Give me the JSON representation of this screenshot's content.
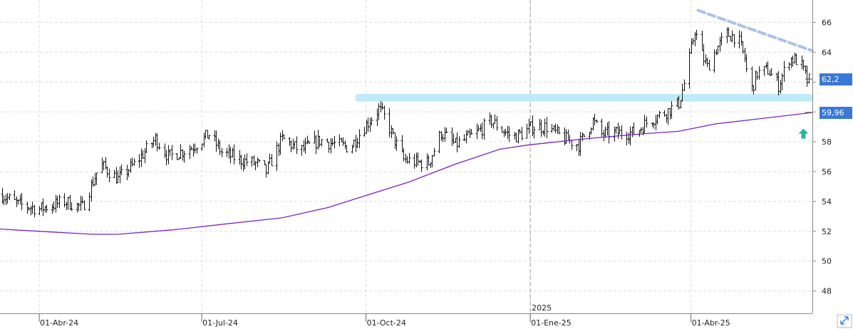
{
  "chart_data": {
    "type": "candlestick",
    "title": "",
    "xlabel": "",
    "ylabel": "",
    "x_range": [
      "2024-03-10",
      "2025-06-08"
    ],
    "ylim": [
      46.5,
      67.5
    ],
    "y_ticks": [
      48,
      50,
      52,
      54,
      56,
      58,
      60,
      62,
      64,
      66
    ],
    "y_tick_labels": [
      "48",
      "50",
      "52",
      "54",
      "56",
      "58",
      "60",
      "62",
      "64",
      "66"
    ],
    "x_ticks": [
      {
        "date": "2024-04-01",
        "label": "01-Abr-24"
      },
      {
        "date": "2024-07-01",
        "label": "01-Jul-24"
      },
      {
        "date": "2024-10-01",
        "label": "01-Oct-24"
      },
      {
        "date": "2025-01-01",
        "label": "01-Ene-25"
      },
      {
        "date": "2025-04-01",
        "label": "01-Abr-25"
      }
    ],
    "year_marker": {
      "date": "2025-01-01",
      "label": "2025"
    },
    "grid": true,
    "price_badge": {
      "value": 62.2,
      "label": "62,2",
      "color": "#3a78d6"
    },
    "ma_badge": {
      "value": 59.96,
      "label": "59,96",
      "color": "#3a78d6"
    },
    "price_anchors": [
      [
        "2024-03-10",
        54.5
      ],
      [
        "2024-03-20",
        53.8
      ],
      [
        "2024-04-01",
        53.5
      ],
      [
        "2024-04-15",
        54.0
      ],
      [
        "2024-04-25",
        53.6
      ],
      [
        "2024-05-05",
        56.5
      ],
      [
        "2024-05-15",
        55.5
      ],
      [
        "2024-05-25",
        56.6
      ],
      [
        "2024-06-05",
        58.2
      ],
      [
        "2024-06-12",
        57.0
      ],
      [
        "2024-06-25",
        57.6
      ],
      [
        "2024-07-05",
        58.5
      ],
      [
        "2024-07-12",
        57.3
      ],
      [
        "2024-07-22",
        56.8
      ],
      [
        "2024-08-01",
        56.5
      ],
      [
        "2024-08-06",
        56.0
      ],
      [
        "2024-08-15",
        58.2
      ],
      [
        "2024-08-25",
        57.4
      ],
      [
        "2024-09-05",
        58.1
      ],
      [
        "2024-09-15",
        57.8
      ],
      [
        "2024-09-22",
        57.6
      ],
      [
        "2024-09-28",
        58.7
      ],
      [
        "2024-10-08",
        60.2
      ],
      [
        "2024-10-12",
        59.5
      ],
      [
        "2024-10-16",
        58.3
      ],
      [
        "2024-10-22",
        56.8
      ],
      [
        "2024-10-30",
        56.6
      ],
      [
        "2024-11-05",
        56.6
      ],
      [
        "2024-11-12",
        58.6
      ],
      [
        "2024-11-20",
        57.8
      ],
      [
        "2024-12-01",
        58.5
      ],
      [
        "2024-12-10",
        59.4
      ],
      [
        "2024-12-16",
        58.8
      ],
      [
        "2024-12-22",
        58.3
      ],
      [
        "2024-12-28",
        58.6
      ],
      [
        "2025-01-02",
        59.0
      ],
      [
        "2025-01-10",
        59.0
      ],
      [
        "2025-01-20",
        58.2
      ],
      [
        "2025-01-28",
        57.8
      ],
      [
        "2025-02-05",
        59.4
      ],
      [
        "2025-02-10",
        58.5
      ],
      [
        "2025-02-20",
        58.6
      ],
      [
        "2025-03-01",
        58.6
      ],
      [
        "2025-03-08",
        59.4
      ],
      [
        "2025-03-18",
        60.0
      ],
      [
        "2025-03-25",
        60.6
      ],
      [
        "2025-03-29",
        62.3
      ],
      [
        "2025-04-03",
        65.5
      ],
      [
        "2025-04-07",
        63.8
      ],
      [
        "2025-04-10",
        63.0
      ],
      [
        "2025-04-15",
        64.2
      ],
      [
        "2025-04-21",
        65.2
      ],
      [
        "2025-04-27",
        65.0
      ],
      [
        "2025-05-01",
        63.6
      ],
      [
        "2025-05-04",
        61.2
      ],
      [
        "2025-05-08",
        62.6
      ],
      [
        "2025-05-14",
        62.8
      ],
      [
        "2025-05-20",
        61.8
      ],
      [
        "2025-05-26",
        63.6
      ],
      [
        "2025-06-01",
        63.4
      ],
      [
        "2025-06-05",
        62.1
      ],
      [
        "2025-06-08",
        62.2
      ]
    ],
    "moving_average": [
      [
        "2024-03-10",
        52.15
      ],
      [
        "2024-04-01",
        52.0
      ],
      [
        "2024-05-01",
        51.8
      ],
      [
        "2024-05-15",
        51.8
      ],
      [
        "2024-06-15",
        52.1
      ],
      [
        "2024-07-15",
        52.5
      ],
      [
        "2024-08-15",
        52.9
      ],
      [
        "2024-09-10",
        53.6
      ],
      [
        "2024-10-01",
        54.4
      ],
      [
        "2024-10-25",
        55.3
      ],
      [
        "2024-11-20",
        56.5
      ],
      [
        "2024-12-15",
        57.5
      ],
      [
        "2025-01-01",
        57.8
      ],
      [
        "2025-02-01",
        58.2
      ],
      [
        "2025-03-01",
        58.5
      ],
      [
        "2025-03-25",
        58.7
      ],
      [
        "2025-04-15",
        59.2
      ],
      [
        "2025-05-10",
        59.55
      ],
      [
        "2025-06-08",
        59.96
      ]
    ],
    "resistance_zone": {
      "start": "2024-09-25",
      "end": "2025-06-08",
      "low": 60.7,
      "high": 61.2,
      "color": "#bfeaf8"
    },
    "trend_line": {
      "points": [
        [
          "2025-04-05",
          66.8
        ],
        [
          "2025-06-08",
          64.1
        ]
      ],
      "color": "#a9c3e8"
    },
    "arrow_marker": {
      "date": "2025-06-03",
      "value": 58.5,
      "color": "#2bb5a3"
    }
  }
}
